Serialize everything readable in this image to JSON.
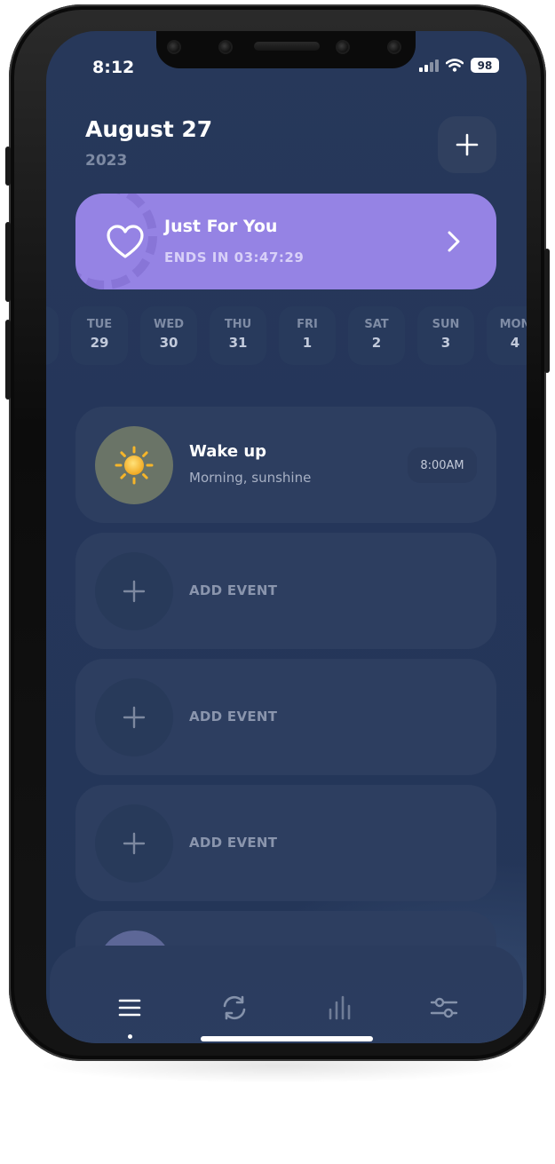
{
  "status_bar": {
    "time": "8:12",
    "battery": "98",
    "icons": [
      "cellular-signal-icon",
      "wifi-icon",
      "battery-icon"
    ]
  },
  "header": {
    "date": "August 27",
    "year": "2023",
    "add_icon": "plus-icon"
  },
  "promo": {
    "title": "Just For You",
    "subtitle": "ENDS IN 03:47:29",
    "icon": "heart-icon",
    "arrow_icon": "chevron-right-icon"
  },
  "week": {
    "days": [
      {
        "name": "TUE",
        "num": "29"
      },
      {
        "name": "WED",
        "num": "30"
      },
      {
        "name": "THU",
        "num": "31"
      },
      {
        "name": "FRI",
        "num": "1"
      },
      {
        "name": "SAT",
        "num": "2"
      },
      {
        "name": "SUN",
        "num": "3"
      },
      {
        "name": "MON",
        "num": "4"
      }
    ]
  },
  "events": [
    {
      "title": "Wake up",
      "subtitle": "Morning, sunshine",
      "time": "8:00AM",
      "icon": "sun-icon"
    }
  ],
  "add_event": {
    "label": "ADD EVENT",
    "icon": "plus-icon"
  },
  "tabbar": {
    "tabs": [
      {
        "icon": "list-icon",
        "active": true
      },
      {
        "icon": "sync-icon",
        "active": false
      },
      {
        "icon": "stats-icon",
        "active": false
      },
      {
        "icon": "settings-sliders-icon",
        "active": false
      }
    ]
  },
  "colors": {
    "background": "#25365a",
    "card": "#2d3e60",
    "accent_purple": "#9583e4",
    "muted_text": "#7f8ca5"
  }
}
